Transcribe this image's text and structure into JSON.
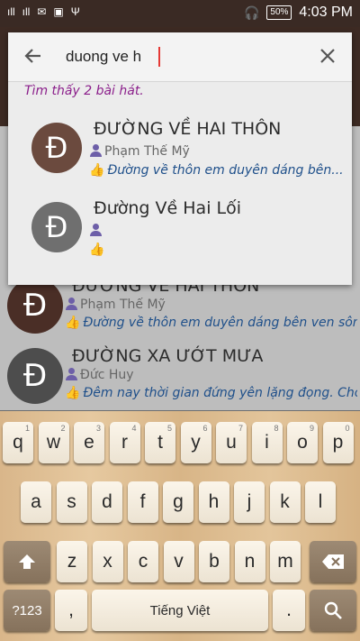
{
  "status": {
    "signal1": "ıll",
    "signal2": "ıll",
    "usb": "Ψ",
    "battery": "50%",
    "time": "4:03 PM"
  },
  "search": {
    "query": "duong ve h",
    "result_count": "Tìm thấy 2 bài hát."
  },
  "results": [
    {
      "avatar": "Đ",
      "title": "ĐƯỜNG VỀ HAI THÔN",
      "artist": "Phạm Thế Mỹ",
      "lyric": "Đường về thôn em duyên dáng bên...",
      "color": "#6b4a3e"
    },
    {
      "avatar": "Đ",
      "title": "Đường Về Hai Lối",
      "artist": "",
      "lyric": "",
      "color": "#6f6f6f"
    }
  ],
  "background_list": [
    {
      "avatar": "Đ",
      "title": "ĐƯỜNG VỀ HAI THÔN",
      "artist": "Phạm Thế Mỹ",
      "lyric": "Đường về thôn em duyên dáng bên ven sôn...",
      "color": "#4a2e26"
    },
    {
      "avatar": "Đ",
      "title": "ĐƯỜNG XA ƯỚT MƯA",
      "artist": "Đức Huy",
      "lyric": "Đêm nay thời gian đứng yên lặng đọng. Cho...",
      "color": "#4d4d4d"
    }
  ],
  "keyboard": {
    "row1": [
      [
        "q",
        "1"
      ],
      [
        "w",
        "2"
      ],
      [
        "e",
        "3"
      ],
      [
        "r",
        "4"
      ],
      [
        "t",
        "5"
      ],
      [
        "y",
        "6"
      ],
      [
        "u",
        "7"
      ],
      [
        "i",
        "8"
      ],
      [
        "o",
        "9"
      ],
      [
        "p",
        "0"
      ]
    ],
    "row2": [
      "a",
      "s",
      "d",
      "f",
      "g",
      "h",
      "j",
      "k",
      "l"
    ],
    "row3": [
      "z",
      "x",
      "c",
      "v",
      "b",
      "n",
      "m"
    ],
    "symbols": "?123",
    "comma": ",",
    "space": "Tiếng Việt",
    "period": "."
  }
}
